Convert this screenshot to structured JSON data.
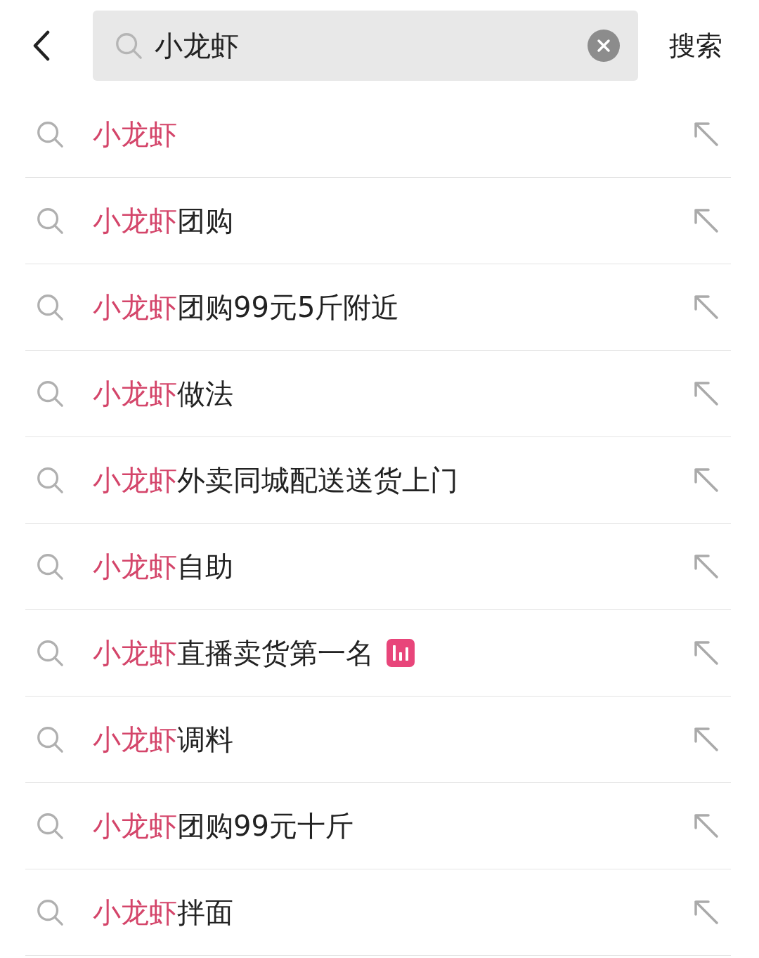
{
  "search": {
    "value": "小龙虾",
    "action": "搜索"
  },
  "suggestions": [
    {
      "match": "小龙虾",
      "trending": false
    },
    {
      "match": "小龙虾",
      "rest": "团购",
      "trending": false
    },
    {
      "match": "小龙虾",
      "rest": "团购99元5斤附近",
      "trending": false
    },
    {
      "match": "小龙虾",
      "rest": "做法",
      "trending": false
    },
    {
      "match": "小龙虾",
      "rest": "外卖同城配送送货上门",
      "trending": false
    },
    {
      "match": "小龙虾",
      "rest": "自助",
      "trending": false
    },
    {
      "match": "小龙虾",
      "rest": "直播卖货第一名",
      "trending": true
    },
    {
      "match": "小龙虾",
      "rest": "调料",
      "trending": false
    },
    {
      "match": "小龙虾",
      "rest": "团购99元十斤",
      "trending": false
    },
    {
      "match": "小龙虾",
      "rest": "拌面",
      "trending": false
    }
  ]
}
